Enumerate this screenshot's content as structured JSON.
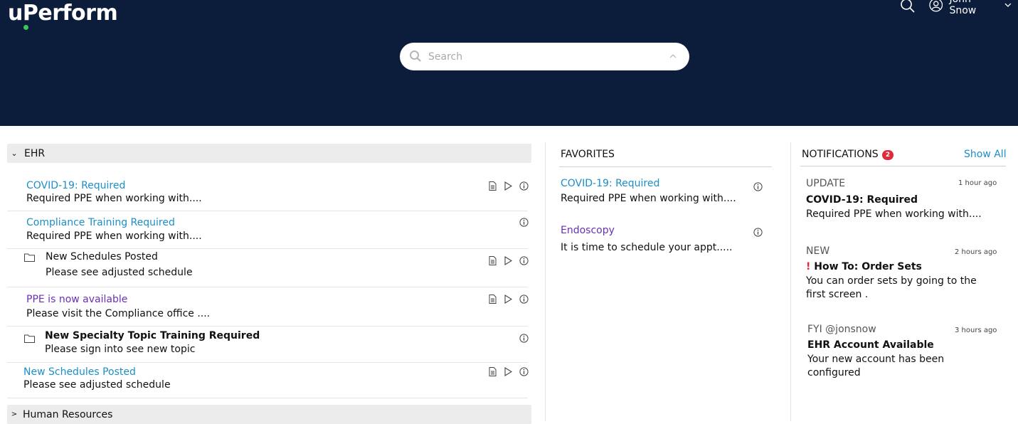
{
  "app": {
    "logo_text": "uPerform"
  },
  "header": {
    "user_name": "John Snow"
  },
  "search": {
    "placeholder": "Search"
  },
  "categories": [
    {
      "label": "EHR",
      "expanded": true
    },
    {
      "label": "Human Resources",
      "expanded": false
    }
  ],
  "items": [
    {
      "title": "COVID-19: Required",
      "desc": "Required PPE when working with....",
      "style": "blue"
    },
    {
      "title": "Compliance Training Required",
      "desc": "Required PPE when working with....",
      "style": "blue"
    },
    {
      "title": "New Schedules Posted",
      "desc": "Please see adjusted schedule",
      "style": "folder"
    },
    {
      "title": "PPE is now available",
      "desc": "Please visit the Compliance office ....",
      "style": "purple"
    },
    {
      "title": "New Specialty Topic Training Required",
      "desc": "Please sign into see new topic",
      "style": "folder-bold"
    },
    {
      "title": "New Schedules Posted",
      "desc": "Please see adjusted schedule",
      "style": "blue"
    }
  ],
  "favorites": {
    "heading": "FAVORITES",
    "items": [
      {
        "title": "COVID-19: Required",
        "desc": "Required PPE when working with...."
      },
      {
        "title": "Endoscopy",
        "desc": "It is time to schedule your appt....."
      }
    ]
  },
  "notifications": {
    "heading": "NOTIFICATIONS",
    "count": "2",
    "show_all": "Show All",
    "items": [
      {
        "type": "UPDATE",
        "time": "1 hour ago",
        "title": "COVID-19: Required",
        "desc": "Required PPE when working with...."
      },
      {
        "type": "NEW",
        "time": "2 hours ago",
        "alert": "!",
        "title": "How To: Order Sets",
        "desc": "You can order sets by going to the first screen ."
      },
      {
        "type": "FYI @jonsnow",
        "time": "3 hours ago",
        "title": "EHR Account Available",
        "desc": "Your new account has been configured"
      }
    ]
  },
  "colors": {
    "header_bg": "#0c1d3b",
    "link_blue": "#1b8fc7",
    "link_purple": "#6a2fb4",
    "badge_red": "#e02a3a",
    "logo_dot": "#3cc65a"
  },
  "icons": [
    "search-icon",
    "user-icon",
    "chevron-down-icon",
    "chevron-up-icon",
    "document-icon",
    "play-icon",
    "info-icon",
    "folder-icon"
  ]
}
